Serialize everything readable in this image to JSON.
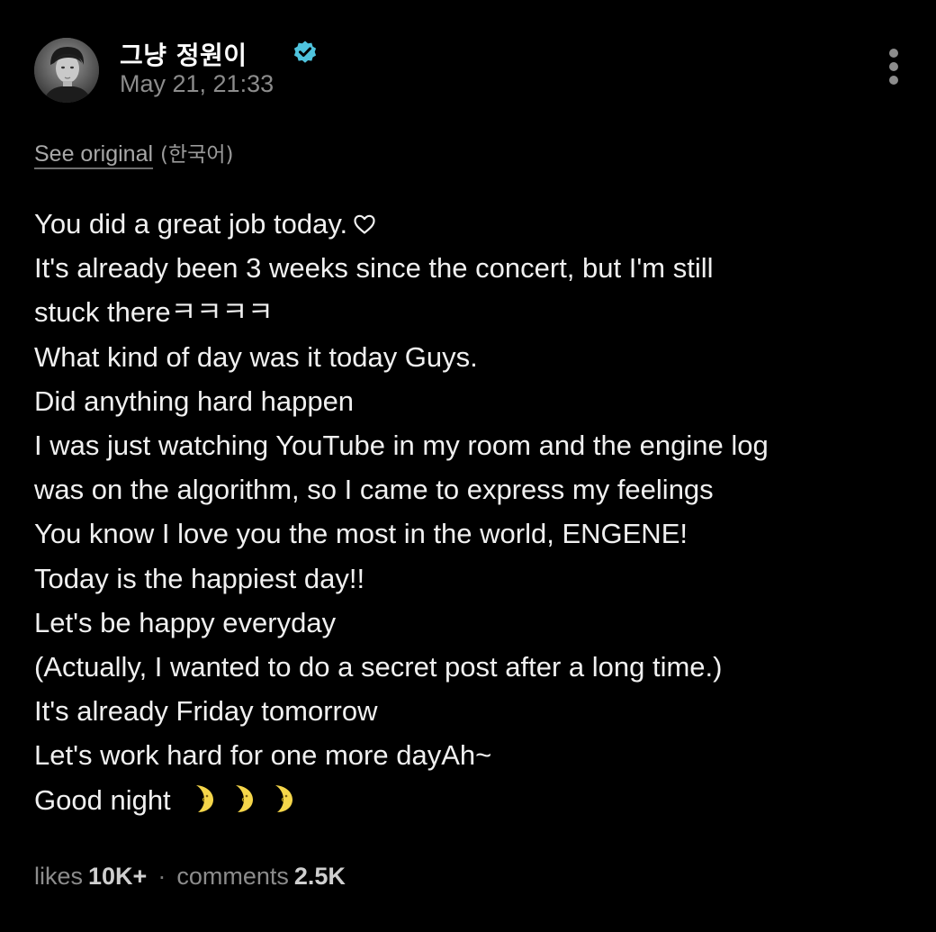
{
  "post": {
    "author_name": "그냥 정원이",
    "timestamp": "May 21, 21:33",
    "verified": true,
    "accent_color": "#4fc3dd",
    "menu_icon": "more-vertical-icon"
  },
  "translation": {
    "see_original_label": "See original",
    "language_label": "(한국어)"
  },
  "body": {
    "lines": [
      "You did a great job today.",
      "It's already been 3 weeks since the concert, but I'm still",
      "stuck thereㅋㅋㅋㅋ",
      "What kind of day was it today Guys.",
      "Did anything hard happen",
      "I was just watching YouTube in my room and the engine log",
      "was on the algorithm, so I came to express my feelings",
      "You know I love you the most in the world, ENGENE!",
      "Today is the happiest day!!",
      "Let's be happy everyday",
      "(Actually, I wanted to do a secret post after a long time.)",
      "It's already Friday tomorrow",
      "Let's work hard for one more dayAh~",
      "Good night"
    ],
    "line1_icon": "heart-outline-icon",
    "last_line_icon": "crescent-moon-icon"
  },
  "stats": {
    "likes_label": "likes",
    "likes_count": "10K+",
    "separator": "·",
    "comments_label": "comments",
    "comments_count": "2.5K"
  }
}
